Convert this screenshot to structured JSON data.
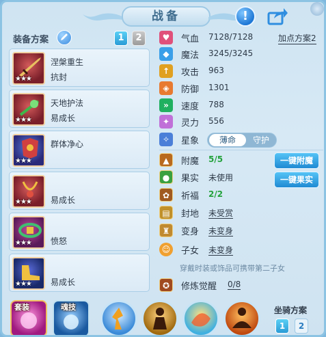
{
  "title": "战备",
  "icons": {
    "help": "exclamation-icon",
    "share": "share-icon",
    "edit": "pen-icon"
  },
  "equip_plan": {
    "label": "装备方案",
    "plans": [
      "1",
      "2"
    ],
    "active": "1"
  },
  "equipment": [
    {
      "name": "涅槃重生",
      "sub": "抗封",
      "stars": "★★★"
    },
    {
      "name": "天地护法",
      "sub": "易成长",
      "stars": "★★★"
    },
    {
      "name": "群体净心",
      "sub": "",
      "stars": "★★★"
    },
    {
      "name": "",
      "sub": "易成长",
      "stars": "★★★"
    },
    {
      "name": "",
      "sub": "愤怒",
      "stars": "★★★"
    },
    {
      "name": "",
      "sub": "易成长",
      "stars": "★★★"
    }
  ],
  "stats": {
    "add_point_plan": "加点方案2",
    "rows": [
      {
        "label": "气血",
        "value": "7128/7128",
        "color": "#e0507a"
      },
      {
        "label": "魔法",
        "value": "3245/3245",
        "color": "#3a9fe8"
      },
      {
        "label": "攻击",
        "value": "963",
        "color": "#e0a020"
      },
      {
        "label": "防御",
        "value": "1301",
        "color": "#e87a30"
      },
      {
        "label": "速度",
        "value": "788",
        "color": "#20b060"
      },
      {
        "label": "灵力",
        "value": "556",
        "color": "#c070d8"
      }
    ],
    "star_image": {
      "label": "星象",
      "options": [
        "薄命",
        "守护"
      ],
      "selected": "薄命"
    }
  },
  "enhance": {
    "rows": [
      {
        "label": "附魔",
        "value": "5/5"
      },
      {
        "label": "果实",
        "value": "未使用"
      },
      {
        "label": "祈福",
        "value": "2/2"
      },
      {
        "label": "封地",
        "value": "未受赏"
      },
      {
        "label": "变身",
        "value": "未变身"
      },
      {
        "label": "子女",
        "value": "未变身"
      }
    ],
    "btn_enchant": "一键附魔",
    "btn_fruit": "一键果实",
    "hint": "穿戴时装或饰品可携带第二子女",
    "awaken_label": "修炼觉醒",
    "awaken_value": "0/8"
  },
  "skills": {
    "suit_label": "套装",
    "soul_label": "魂技",
    "mount_label": "坐骑方案",
    "mount_plans": [
      "1",
      "2"
    ],
    "mount_active": "1"
  }
}
